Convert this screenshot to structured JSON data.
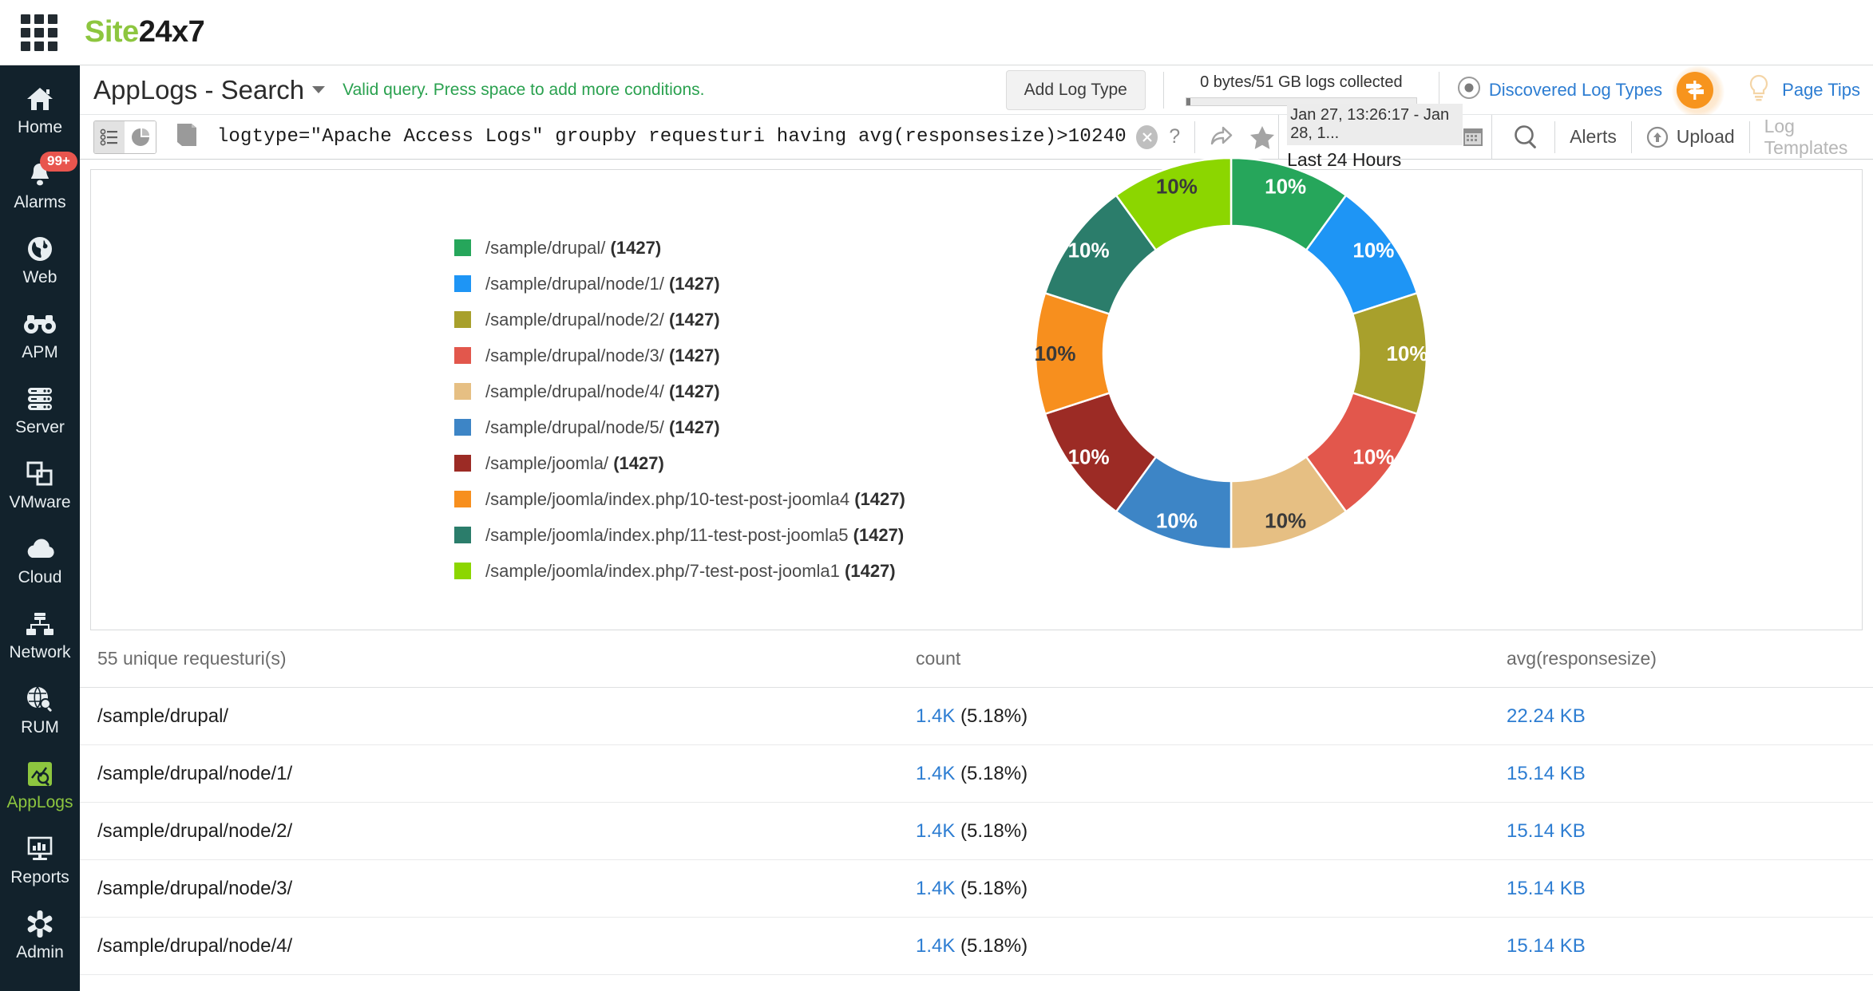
{
  "brand": {
    "logo_site": "Site",
    "logo_24x7": "24x7",
    "waffle_icon": "apps-grid-icon"
  },
  "sidebar": {
    "items": [
      {
        "label": "Home",
        "icon": "home-icon",
        "active": false
      },
      {
        "label": "Alarms",
        "icon": "bell-icon",
        "active": false,
        "badge": "99+"
      },
      {
        "label": "Web",
        "icon": "globe-icon",
        "active": false
      },
      {
        "label": "APM",
        "icon": "binoculars-icon",
        "active": false
      },
      {
        "label": "Server",
        "icon": "server-rack-icon",
        "active": false
      },
      {
        "label": "VMware",
        "icon": "windows-stack-icon",
        "active": false
      },
      {
        "label": "Cloud",
        "icon": "cloud-icon",
        "active": false
      },
      {
        "label": "Network",
        "icon": "network-icon",
        "active": false
      },
      {
        "label": "RUM",
        "icon": "globe-search-icon",
        "active": false
      },
      {
        "label": "AppLogs",
        "icon": "applogs-icon",
        "active": true
      },
      {
        "label": "Reports",
        "icon": "report-chart-icon",
        "active": false
      },
      {
        "label": "Admin",
        "icon": "gear-icon",
        "active": false
      }
    ]
  },
  "header": {
    "title": "AppLogs - Search",
    "title_caret_icon": "chevron-down-icon",
    "validation_message": "Valid query. Press space to add more conditions.",
    "add_log_type_label": "Add Log Type",
    "quota_text": "0 bytes/51 GB logs collected",
    "quota_percent": 0,
    "eye_icon": "eye-icon",
    "discovered_log_types_label": "Discovered Log Types",
    "page_tips_label": "Page Tips",
    "page_tips_icon": "signpost-icon",
    "bulb_icon": "lightbulb-icon",
    "accent_color": "#f7941d",
    "link_color": "#2d7dd2",
    "valid_color": "#2aa14f"
  },
  "querybar": {
    "view_list_icon": "list-view-icon",
    "view_chart_icon": "pie-chart-view-icon",
    "book_icon": "book-icon",
    "query": "logtype=\"Apache Access Logs\" groupby requesturi having avg(responsesize)>10240",
    "clear_icon": "clear-circle-icon",
    "help_icon": "question-mark-icon",
    "share_icon": "share-icon",
    "favorite_icon": "star-icon",
    "date_range_value": "Jan 27, 13:26:17 - Jan 28, 1...",
    "date_range_preset": "Last 24 Hours",
    "calendar_icon": "calendar-icon",
    "search_icon": "search-icon",
    "alerts_label": "Alerts",
    "upload_label": "Upload",
    "upload_icon": "upload-icon",
    "log_templates_label": "Log Templates"
  },
  "chart_data": {
    "type": "pie",
    "title": "",
    "subtitle": "",
    "xlabel": "",
    "ylabel": "",
    "legend_position": "left",
    "donut": true,
    "slice_label_format": "percent",
    "categories": [
      "/sample/drupal/",
      "/sample/drupal/node/1/",
      "/sample/drupal/node/2/",
      "/sample/drupal/node/3/",
      "/sample/drupal/node/4/",
      "/sample/drupal/node/5/",
      "/sample/joomla/",
      "/sample/joomla/index.php/10-test-post-joomla4",
      "/sample/joomla/index.php/11-test-post-joomla5",
      "/sample/joomla/index.php/7-test-post-joomla1"
    ],
    "values": [
      1427,
      1427,
      1427,
      1427,
      1427,
      1427,
      1427,
      1427,
      1427,
      1427
    ],
    "percent_labels": [
      "10%",
      "10%",
      "10%",
      "10%",
      "10%",
      "10%",
      "10%",
      "10%",
      "10%",
      "10%"
    ],
    "colors": [
      "#26a65b",
      "#1e95f5",
      "#a8a02c",
      "#e2574c",
      "#e6bf83",
      "#3d85c6",
      "#9c2b25",
      "#f78f1e",
      "#2b7d6b",
      "#8cd600"
    ],
    "label_text_colors": [
      "#ffffff",
      "#ffffff",
      "#ffffff",
      "#ffffff",
      "#3a3a3a",
      "#ffffff",
      "#ffffff",
      "#3a3a3a",
      "#ffffff",
      "#3a3a3a"
    ],
    "legend_entries": [
      {
        "label": "/sample/drupal/",
        "count": "(1427)",
        "color": "#26a65b"
      },
      {
        "label": "/sample/drupal/node/1/",
        "count": "(1427)",
        "color": "#1e95f5"
      },
      {
        "label": "/sample/drupal/node/2/",
        "count": "(1427)",
        "color": "#a8a02c"
      },
      {
        "label": "/sample/drupal/node/3/",
        "count": "(1427)",
        "color": "#e2574c"
      },
      {
        "label": "/sample/drupal/node/4/",
        "count": "(1427)",
        "color": "#e6bf83"
      },
      {
        "label": "/sample/drupal/node/5/",
        "count": "(1427)",
        "color": "#3d85c6"
      },
      {
        "label": "/sample/joomla/",
        "count": "(1427)",
        "color": "#9c2b25"
      },
      {
        "label": "/sample/joomla/index.php/10-test-post-joomla4",
        "count": "(1427)",
        "color": "#f78f1e"
      },
      {
        "label": "/sample/joomla/index.php/11-test-post-joomla5",
        "count": "(1427)",
        "color": "#2b7d6b"
      },
      {
        "label": "/sample/joomla/index.php/7-test-post-joomla1",
        "count": "(1427)",
        "color": "#8cd600"
      }
    ]
  },
  "table": {
    "headers": [
      "55 unique requesturi(s)",
      "count",
      "avg(responsesize)"
    ],
    "rows": [
      {
        "requesturi": "/sample/drupal/",
        "count_value": "1.4K",
        "count_pct": "(5.18%)",
        "avg": "22.24 KB"
      },
      {
        "requesturi": "/sample/drupal/node/1/",
        "count_value": "1.4K",
        "count_pct": "(5.18%)",
        "avg": "15.14 KB"
      },
      {
        "requesturi": "/sample/drupal/node/2/",
        "count_value": "1.4K",
        "count_pct": "(5.18%)",
        "avg": "15.14 KB"
      },
      {
        "requesturi": "/sample/drupal/node/3/",
        "count_value": "1.4K",
        "count_pct": "(5.18%)",
        "avg": "15.14 KB"
      },
      {
        "requesturi": "/sample/drupal/node/4/",
        "count_value": "1.4K",
        "count_pct": "(5.18%)",
        "avg": "15.14 KB"
      }
    ]
  }
}
